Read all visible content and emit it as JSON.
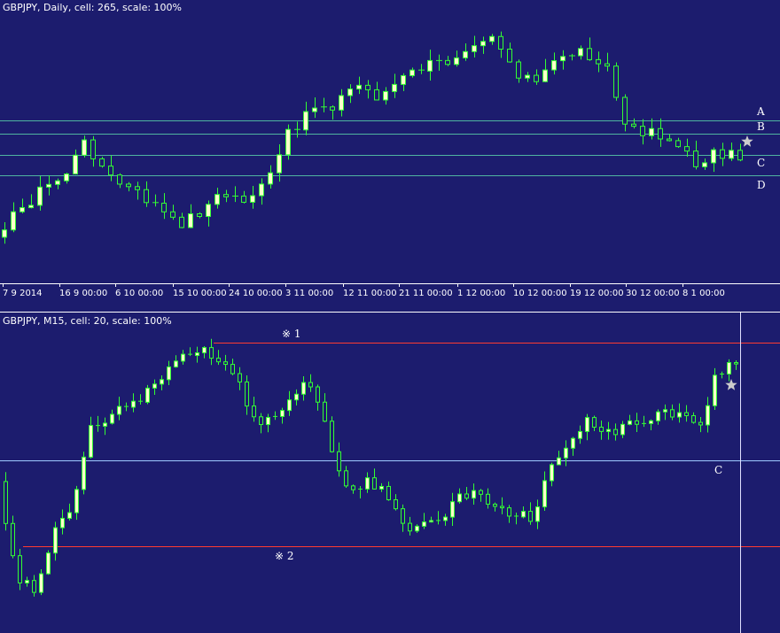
{
  "colors": {
    "background": "#1c1c6e",
    "candle_up": "#1c1c6e",
    "candle_down": "#ffffcc",
    "wick": "#33ff33",
    "level_line": "#4fb3a0",
    "level_line_lower": "#9ec9ff",
    "red_line": "#ff3b30",
    "separator": "#ffffff",
    "star": "#cccccc"
  },
  "chart_data": [
    {
      "type": "candlestick",
      "title": "GBPJPY, Daily, cell: 265, scale: 100%",
      "x_tick_labels": [
        "7 9 2014",
        "16 9 00:00",
        "6 10 00:00",
        "15 10 00:00",
        "24 10 00:00",
        "3 11 00:00",
        "12 11 00:00",
        "21 11 00:00",
        "1 12 00:00",
        "10 12 00:00",
        "19 12 00:00",
        "30 12 00:00",
        "8 1 00:00"
      ],
      "level_labels": [
        "A",
        "B",
        "C",
        "D"
      ],
      "star_icon": "star-icon"
    },
    {
      "type": "candlestick",
      "title": "GBPJPY, M15, cell: 20, scale: 100%",
      "level_labels": [
        "※ 1",
        "※ 2",
        "C"
      ],
      "star_icon": "star-icon"
    }
  ]
}
